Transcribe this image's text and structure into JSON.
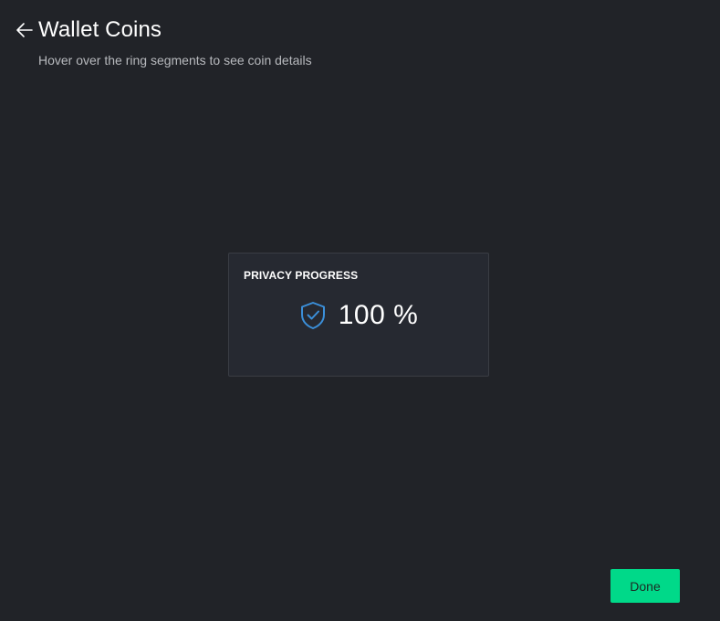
{
  "header": {
    "back_icon": "arrow-left-icon",
    "title": "Wallet Coins",
    "subtitle": "Hover over the ring segments to see coin details"
  },
  "privacy_card": {
    "title": "PRIVACY PROGRESS",
    "icon": "shield-check-icon",
    "value": "100 %"
  },
  "footer": {
    "done_label": "Done"
  },
  "colors": {
    "background": "#212328",
    "card_background": "#262931",
    "accent_green": "#00d989",
    "shield_blue": "#3b8fd9"
  }
}
